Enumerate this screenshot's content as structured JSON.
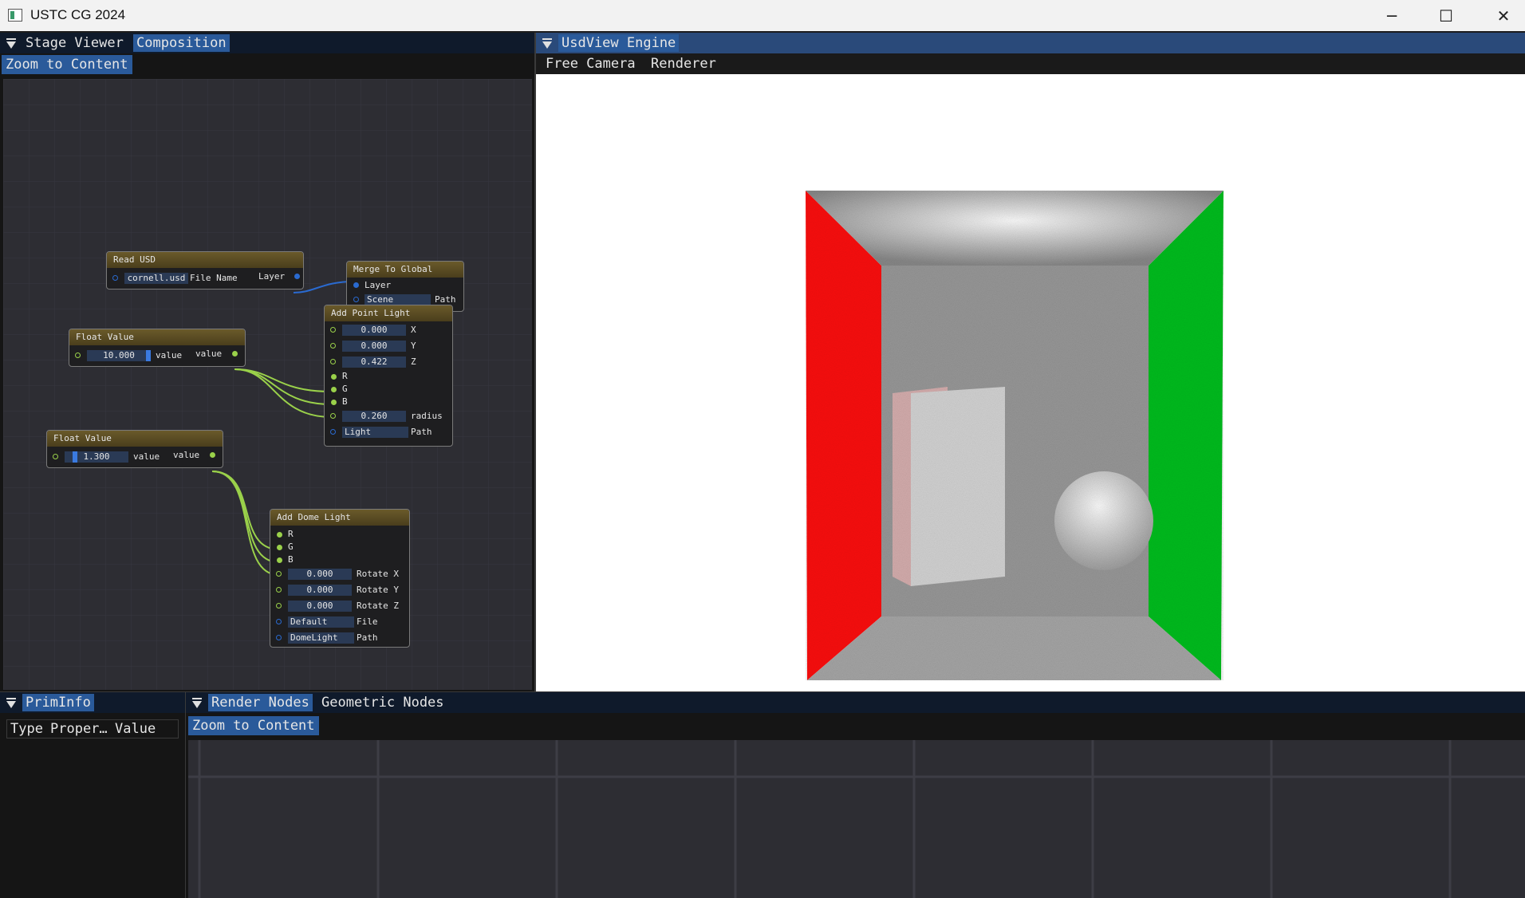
{
  "window": {
    "title": "USTC CG 2024"
  },
  "left_panel": {
    "tabs": [
      "Stage Viewer",
      "Composition"
    ],
    "zoom_button": "Zoom to Content",
    "nodes": {
      "read_usd": {
        "title": "Read USD",
        "file_value": "cornell.usd",
        "file_label": "File Name",
        "out_label": "Layer"
      },
      "merge": {
        "title": "Merge To Global",
        "in_label": "Layer",
        "scene_value": "Scene",
        "path_label": "Path"
      },
      "float1": {
        "title": "Float Value",
        "value": "10.000",
        "in_label": "value",
        "out_label": "value"
      },
      "float2": {
        "title": "Float Value",
        "value": "1.300",
        "in_label": "value",
        "out_label": "value"
      },
      "point_light": {
        "title": "Add Point Light",
        "x": "0.000",
        "x_label": "X",
        "y": "0.000",
        "y_label": "Y",
        "z": "0.422",
        "z_label": "Z",
        "r_label": "R",
        "g_label": "G",
        "b_label": "B",
        "radius": "0.260",
        "radius_label": "radius",
        "path_value": "Light",
        "path_label": "Path"
      },
      "dome_light": {
        "title": "Add Dome Light",
        "r_label": "R",
        "g_label": "G",
        "b_label": "B",
        "rx": "0.000",
        "rx_label": "Rotate X",
        "ry": "0.000",
        "ry_label": "Rotate Y",
        "rz": "0.000",
        "rz_label": "Rotate Z",
        "file_value": "Default",
        "file_label": "File",
        "path_value": "DomeLight",
        "path_label": "Path"
      }
    }
  },
  "viewport": {
    "tab": "UsdView Engine",
    "menu": [
      "Free Camera",
      "Renderer"
    ]
  },
  "prim_info": {
    "tab": "PrimInfo",
    "columns": [
      "Type",
      "Proper…",
      "Value"
    ]
  },
  "bottom_graph": {
    "tabs": [
      "Render Nodes",
      "Geometric Nodes"
    ],
    "zoom_button": "Zoom to Content"
  }
}
